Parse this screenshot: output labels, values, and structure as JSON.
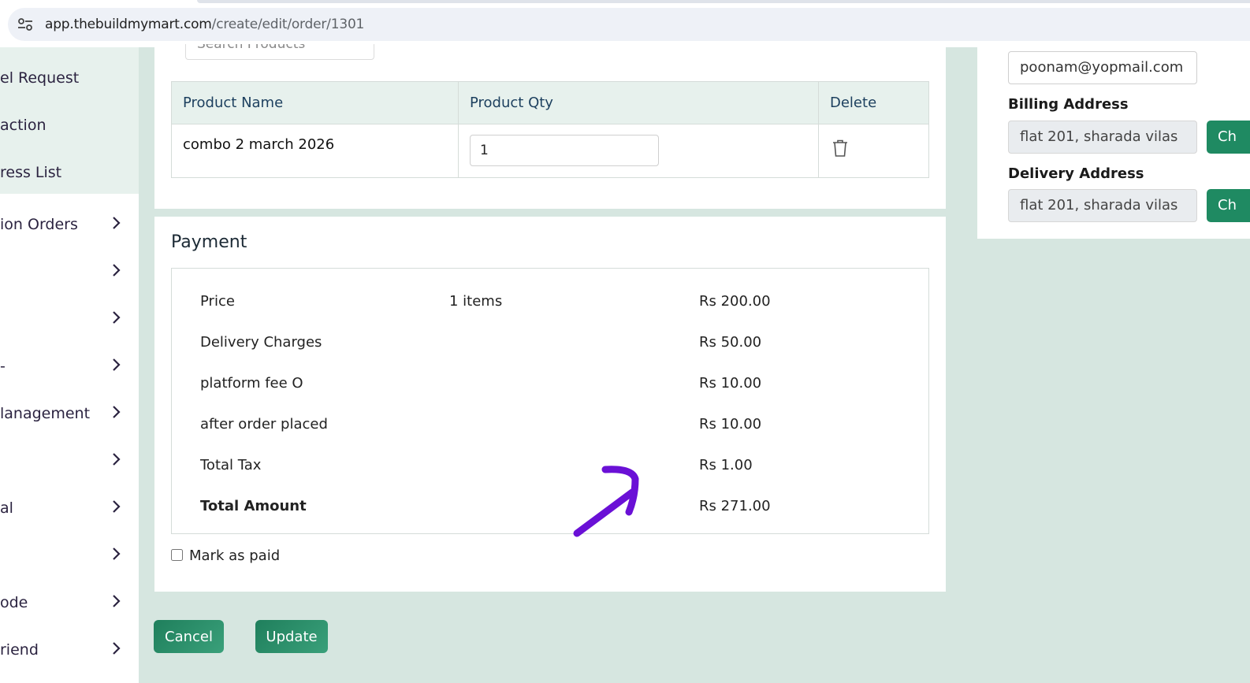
{
  "browser": {
    "url_host": "app.thebuildmymart.com",
    "url_path": "/create/edit/order/1301",
    "site_info_icon": "tune-icon"
  },
  "sidebar": {
    "items": [
      {
        "label": "el Request",
        "chevron": false
      },
      {
        "label": "action",
        "chevron": false
      },
      {
        "label": "ress List",
        "chevron": false
      },
      {
        "label": "ion Orders",
        "chevron": true
      },
      {
        "label": "",
        "chevron": true
      },
      {
        "label": "",
        "chevron": true
      },
      {
        "label": "-",
        "chevron": true
      },
      {
        "label": "lanagement",
        "chevron": true
      },
      {
        "label": "",
        "chevron": true
      },
      {
        "label": "al",
        "chevron": true
      },
      {
        "label": "",
        "chevron": true
      },
      {
        "label": "ode",
        "chevron": true
      },
      {
        "label": "riend",
        "chevron": true
      }
    ]
  },
  "products": {
    "search_placeholder": "Search Products",
    "headers": {
      "name": "Product Name",
      "qty": "Product Qty",
      "delete": "Delete"
    },
    "rows": [
      {
        "name": "combo 2 march 2026",
        "qty": "1",
        "delete_icon": "trash-icon"
      }
    ]
  },
  "payment": {
    "title": "Payment",
    "rows": [
      {
        "label": "Price",
        "middle": "1 items",
        "amount": "Rs 200.00",
        "bold": false
      },
      {
        "label": "Delivery Charges",
        "middle": "",
        "amount": "Rs 50.00",
        "bold": false
      },
      {
        "label": "platform fee O",
        "middle": "",
        "amount": "Rs 10.00",
        "bold": false
      },
      {
        "label": "after order placed",
        "middle": "",
        "amount": "Rs 10.00",
        "bold": false
      },
      {
        "label": "Total Tax",
        "middle": "",
        "amount": "Rs 1.00",
        "bold": false
      },
      {
        "label": "Total Amount",
        "middle": "",
        "amount": "Rs 271.00",
        "bold": true
      }
    ],
    "mark_paid_label": "Mark as paid",
    "mark_paid_checked": false
  },
  "actions": {
    "cancel": "Cancel",
    "update": "Update"
  },
  "customer": {
    "email": "poonam@yopmail.com",
    "billing_label": "Billing Address",
    "billing_value": "flat 201, sharada vilas",
    "delivery_label": "Delivery Address",
    "delivery_value": "flat 201, sharada vilas",
    "change_button": "Ch"
  },
  "colors": {
    "accent": "#1f8a62",
    "page_background": "#d6e6e0",
    "table_header": "#e7f1ed",
    "annotation": "#6a10d6"
  }
}
